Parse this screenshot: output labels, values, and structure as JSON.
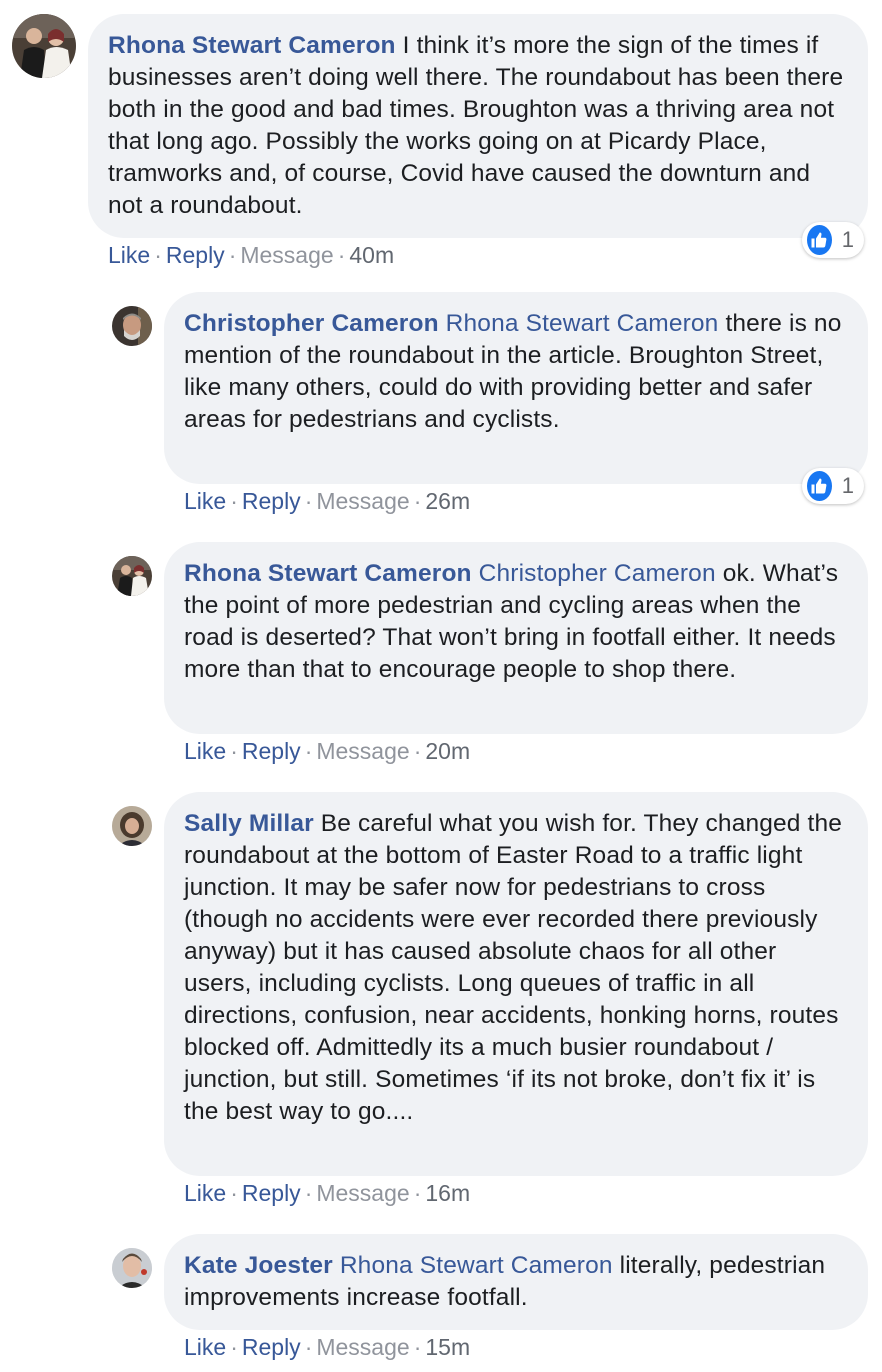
{
  "comments": [
    {
      "author": "Rhona Stewart Cameron",
      "mention": "",
      "text": "I think it’s more the sign of the times if businesses aren’t doing well there. The roundabout has been there both in the good and bad times. Broughton was a thriving area not that long ago. Possibly the works going on at Picardy Place, tramworks and, of course, Covid have caused the downturn and not a roundabout.",
      "like_label": "Like",
      "reply_label": "Reply",
      "message_label": "Message",
      "time": "40m",
      "reaction_count": "1"
    },
    {
      "author": "Christopher Cameron",
      "mention": "Rhona Stewart Cameron",
      "text": "there is no mention of the roundabout in the article. Broughton Street, like many others, could do with providing better and safer areas for pedestrians and cyclists.",
      "like_label": "Like",
      "reply_label": "Reply",
      "message_label": "Message",
      "time": "26m",
      "reaction_count": "1"
    },
    {
      "author": "Rhona Stewart Cameron",
      "mention": "Christopher Cameron",
      "text": "ok. What’s the point of more pedestrian and cycling areas when the road is deserted? That won’t bring in footfall either. It needs more than that to encourage people to shop there.",
      "like_label": "Like",
      "reply_label": "Reply",
      "message_label": "Message",
      "time": "20m"
    },
    {
      "author": "Sally Millar",
      "mention": "",
      "text": "Be careful what you wish for. They changed the roundabout at the bottom of Easter Road to a traffic light junction. It may be safer now for pedestrians to cross (though no accidents were ever recorded there previously anyway) but it has caused absolute chaos for all other users, including cyclists. Long queues of traffic in all directions, confusion, near accidents, honking horns, routes blocked off. Admittedly its a much busier roundabout / junction, but still. Sometimes ‘if its not broke, don’t fix it’ is the best way to go....",
      "like_label": "Like",
      "reply_label": "Reply",
      "message_label": "Message",
      "time": "16m"
    },
    {
      "author": "Kate Joester",
      "mention": "Rhona Stewart Cameron",
      "text": "literally, pedestrian improvements increase footfall.",
      "like_label": "Like",
      "reply_label": "Reply",
      "message_label": "Message",
      "time": "15m"
    }
  ],
  "icons": {
    "reaction": "thumbs-up-icon"
  },
  "colors": {
    "link": "#385898",
    "bubble": "#f0f2f5",
    "like_blue": "#1877f2"
  }
}
